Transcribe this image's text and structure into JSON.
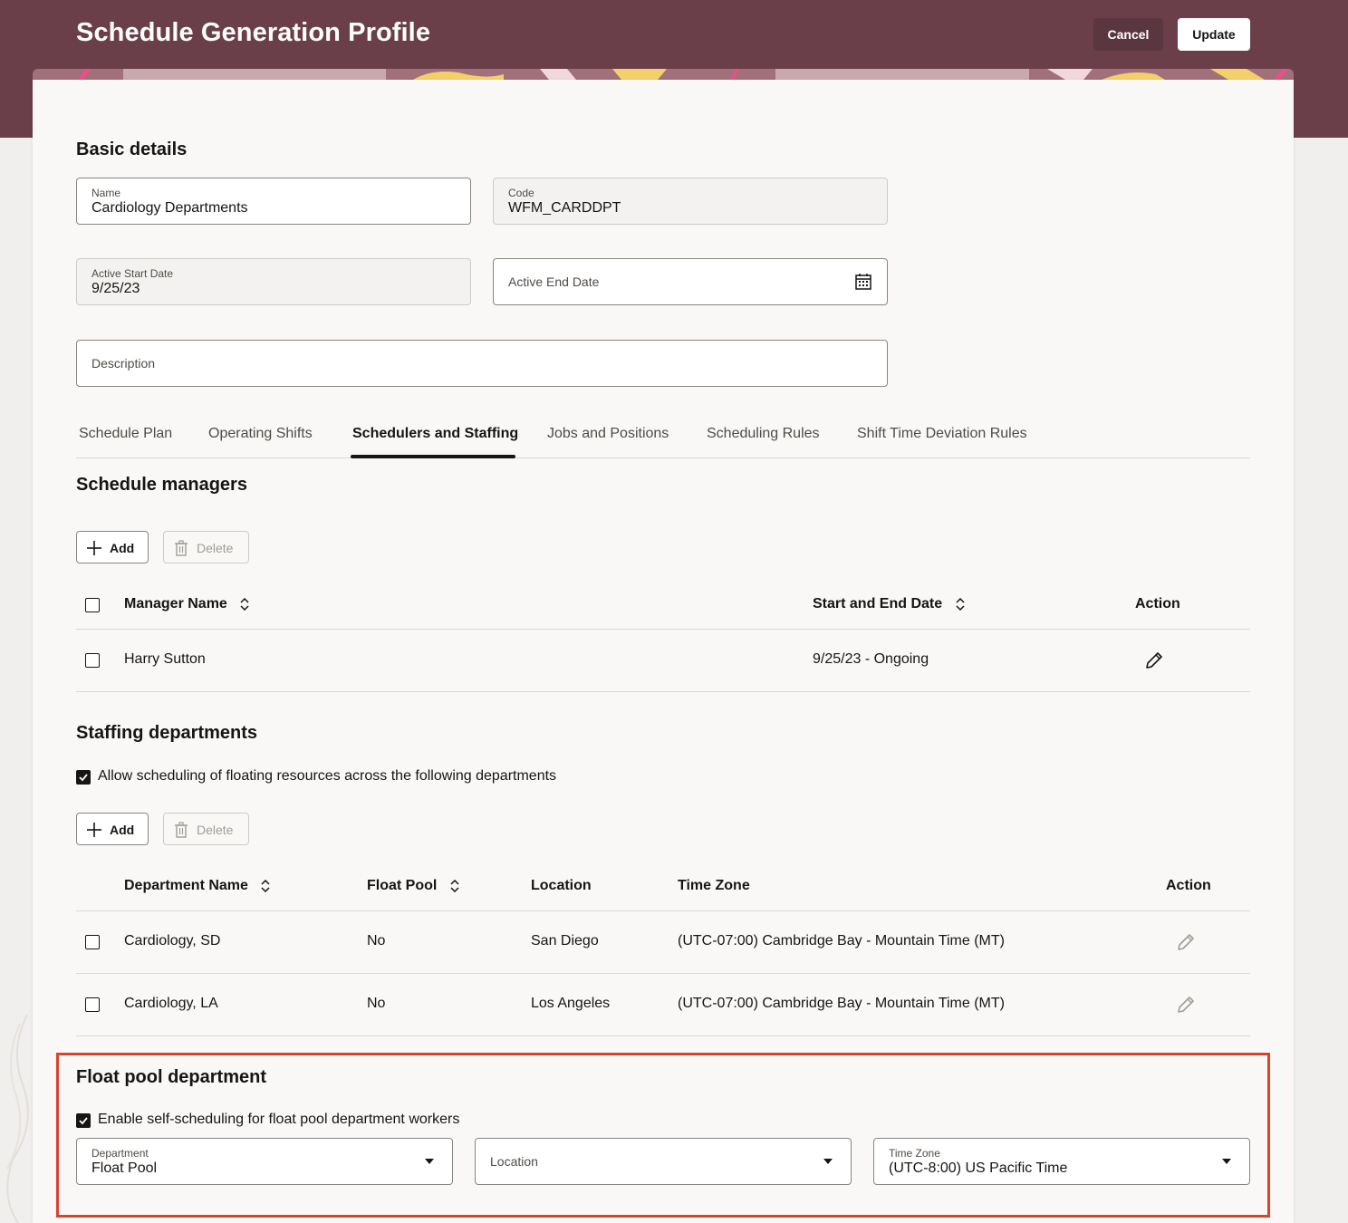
{
  "header": {
    "title": "Schedule Generation Profile",
    "cancel_label": "Cancel",
    "update_label": "Update",
    "colors": {
      "band": "#6b3f4a",
      "highlight": "#d9432e"
    }
  },
  "basic": {
    "heading": "Basic details",
    "name": {
      "label": "Name",
      "value": "Cardiology Departments"
    },
    "code": {
      "label": "Code",
      "value": "WFM_CARDDPT"
    },
    "start_date": {
      "label": "Active Start Date",
      "value": "9/25/23"
    },
    "end_date": {
      "placeholder": "Active End Date",
      "icon": "calendar-icon"
    },
    "description": {
      "placeholder": "Description"
    }
  },
  "tabs": [
    {
      "label": "Schedule Plan"
    },
    {
      "label": "Operating Shifts"
    },
    {
      "label": "Schedulers and Staffing",
      "active": true
    },
    {
      "label": "Jobs and Positions"
    },
    {
      "label": "Scheduling Rules"
    },
    {
      "label": "Shift Time Deviation Rules"
    }
  ],
  "managers": {
    "heading": "Schedule managers",
    "add_label": "Add",
    "delete_label": "Delete",
    "columns": {
      "name": "Manager Name",
      "dates": "Start and End Date",
      "action": "Action"
    },
    "rows": [
      {
        "name": "Harry Sutton",
        "dates": "9/25/23 - Ongoing",
        "action_icon": "pencil-icon"
      }
    ]
  },
  "staffing": {
    "heading": "Staffing departments",
    "allow_label": "Allow scheduling of floating resources across the following departments",
    "allow_checked": true,
    "add_label": "Add",
    "delete_label": "Delete",
    "columns": {
      "dept": "Department Name",
      "float": "Float Pool",
      "location": "Location",
      "tz": "Time Zone",
      "action": "Action"
    },
    "rows": [
      {
        "dept": "Cardiology, SD",
        "float": "No",
        "location": "San Diego",
        "tz": "(UTC-07:00) Cambridge Bay - Mountain Time (MT)"
      },
      {
        "dept": "Cardiology, LA",
        "float": "No",
        "location": "Los Angeles",
        "tz": "(UTC-07:00) Cambridge Bay - Mountain Time (MT)"
      }
    ]
  },
  "floatpool": {
    "heading": "Float pool department",
    "enable_label": "Enable self-scheduling for float pool department workers",
    "enable_checked": true,
    "department": {
      "label": "Department",
      "value": "Float Pool"
    },
    "location": {
      "placeholder": "Location"
    },
    "timezone": {
      "label": "Time Zone",
      "value": "(UTC-8:00) US Pacific Time"
    }
  }
}
